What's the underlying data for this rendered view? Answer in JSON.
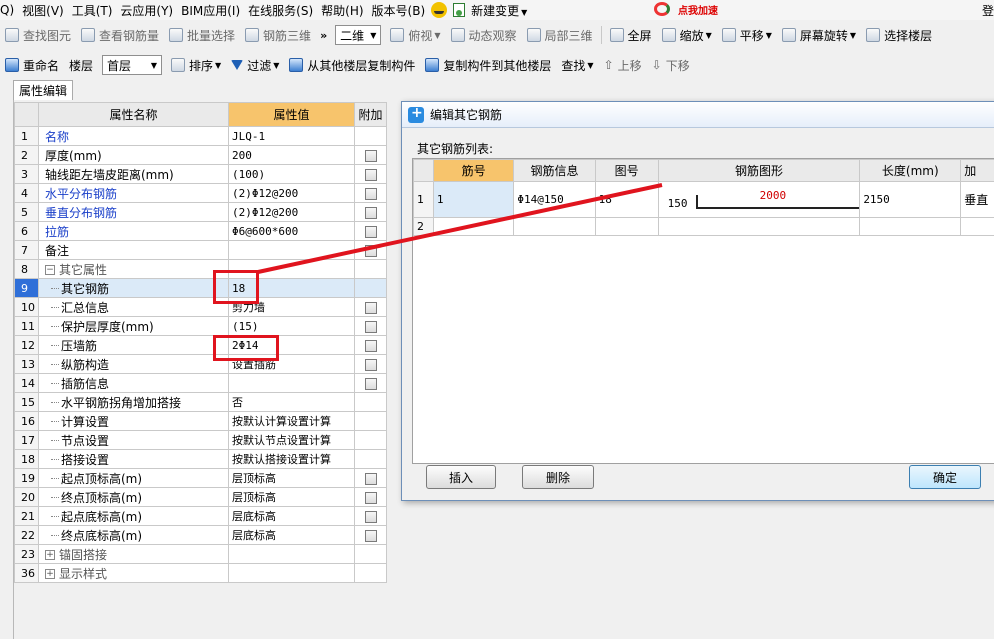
{
  "menubar": {
    "items": [
      "Q)",
      "视图(V)",
      "工具(T)",
      "云应用(Y)",
      "BIM应用(I)",
      "在线服务(S)",
      "帮助(H)",
      "版本号(B)"
    ],
    "update_label": "新建变更",
    "accel_label": "点我加速",
    "corner_text": "登"
  },
  "toolbar1": {
    "find_element": "查找图元",
    "view_rebar_qty": "查看钢筋量",
    "batch_select": "批量选择",
    "rebar_3d": "钢筋三维",
    "view_mode": "二维",
    "top_view": "俯视",
    "dynamic_observe": "动态观察",
    "local_3d": "局部三维",
    "fullscreen": "全屏",
    "zoom": "缩放",
    "pan": "平移",
    "screen_rotate": "屏幕旋转",
    "select_floor": "选择楼层"
  },
  "toolbar2": {
    "rename": "重命名",
    "floor_label": "楼层",
    "floor_value": "首层",
    "sort": "排序",
    "filter": "过滤",
    "copy_from_floor": "从其他楼层复制构件",
    "copy_to_floor": "复制构件到其他楼层",
    "find": "查找",
    "move_up": "上移",
    "move_down": "下移"
  },
  "panel": {
    "tab": "属性编辑",
    "headers": {
      "name": "属性名称",
      "value": "属性值",
      "extra": "附加"
    },
    "rows": [
      {
        "num": "1",
        "name": "名称",
        "value": "JLQ-1",
        "style": "blue",
        "checkbox": false
      },
      {
        "num": "2",
        "name": "厚度(mm)",
        "value": "200",
        "style": "plain",
        "checkbox": true
      },
      {
        "num": "3",
        "name": "轴线距左墙皮距离(mm)",
        "value": "(100)",
        "style": "plain",
        "checkbox": true
      },
      {
        "num": "4",
        "name": "水平分布钢筋",
        "value": "(2)Φ12@200",
        "style": "blue",
        "checkbox": true
      },
      {
        "num": "5",
        "name": "垂直分布钢筋",
        "value": "(2)Φ12@200",
        "style": "blue",
        "checkbox": true
      },
      {
        "num": "6",
        "name": "拉筋",
        "value": "Φ6@600*600",
        "style": "blue",
        "checkbox": true
      },
      {
        "num": "7",
        "name": "备注",
        "value": "",
        "style": "plain",
        "checkbox": true
      },
      {
        "num": "8",
        "name": "其它属性",
        "value": "",
        "style": "group",
        "checkbox": false
      },
      {
        "num": "9",
        "name": "其它钢筋",
        "value": "18",
        "style": "tree",
        "checkbox": false,
        "selected": true
      },
      {
        "num": "10",
        "name": "汇总信息",
        "value": "剪力墙",
        "style": "tree",
        "checkbox": true
      },
      {
        "num": "11",
        "name": "保护层厚度(mm)",
        "value": "(15)",
        "style": "tree",
        "checkbox": true
      },
      {
        "num": "12",
        "name": "压墙筋",
        "value": "2Φ14",
        "style": "tree",
        "checkbox": true
      },
      {
        "num": "13",
        "name": "纵筋构造",
        "value": "设置插筋",
        "style": "tree",
        "checkbox": true
      },
      {
        "num": "14",
        "name": "插筋信息",
        "value": "",
        "style": "tree",
        "checkbox": true
      },
      {
        "num": "15",
        "name": "水平钢筋拐角增加搭接",
        "value": "否",
        "style": "tree",
        "checkbox": false
      },
      {
        "num": "16",
        "name": "计算设置",
        "value": "按默认计算设置计算",
        "style": "tree",
        "checkbox": false
      },
      {
        "num": "17",
        "name": "节点设置",
        "value": "按默认节点设置计算",
        "style": "tree",
        "checkbox": false
      },
      {
        "num": "18",
        "name": "搭接设置",
        "value": "按默认搭接设置计算",
        "style": "tree",
        "checkbox": false
      },
      {
        "num": "19",
        "name": "起点顶标高(m)",
        "value": "层顶标高",
        "style": "tree",
        "checkbox": true
      },
      {
        "num": "20",
        "name": "终点顶标高(m)",
        "value": "层顶标高",
        "style": "tree",
        "checkbox": true
      },
      {
        "num": "21",
        "name": "起点底标高(m)",
        "value": "层底标高",
        "style": "tree",
        "checkbox": true
      },
      {
        "num": "22",
        "name": "终点底标高(m)",
        "value": "层底标高",
        "style": "tree",
        "checkbox": true
      },
      {
        "num": "23",
        "name": "锚固搭接",
        "value": "",
        "style": "collapsed",
        "checkbox": false
      },
      {
        "num": "36",
        "name": "显示样式",
        "value": "",
        "style": "collapsed",
        "checkbox": false
      }
    ]
  },
  "dialog": {
    "title": "编辑其它钢筋",
    "list_label": "其它钢筋列表:",
    "columns": [
      "筋号",
      "钢筋信息",
      "图号",
      "钢筋图形",
      "长度(mm)",
      "加"
    ],
    "rows": [
      {
        "num": "1",
        "bar_no": "1",
        "info": "Φ14@150",
        "fig_no": "18",
        "shape_left": "150",
        "shape_len": "2000",
        "length": "2150",
        "extra": "垂直"
      },
      {
        "num": "2",
        "bar_no": "",
        "info": "",
        "fig_no": "",
        "shape_left": "",
        "shape_len": "",
        "length": "",
        "extra": ""
      }
    ],
    "buttons": {
      "insert": "插入",
      "delete": "删除",
      "ok": "确定"
    }
  },
  "colors": {
    "annotation": "#e0141e",
    "value_header": "#f7c46c",
    "selection": "#dbeaf8",
    "link_blue": "#1a3fc9"
  }
}
